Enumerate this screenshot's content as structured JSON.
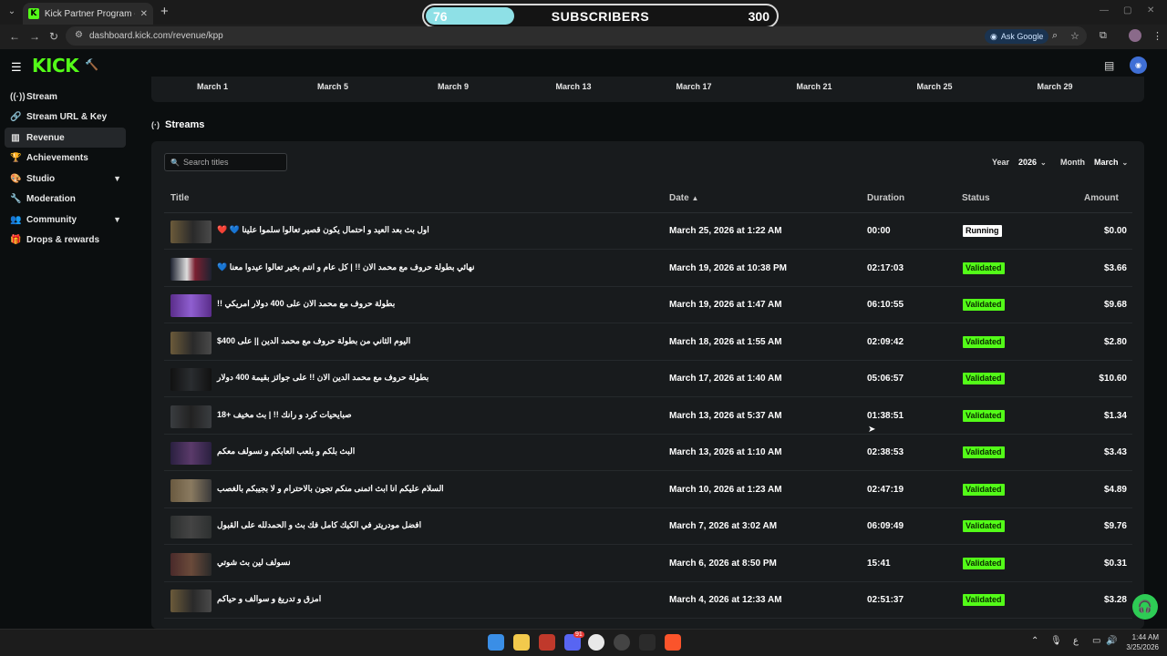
{
  "browser": {
    "tab_title": "Kick Partner Program - Kick Da",
    "url": "dashboard.kick.com/revenue/kpp",
    "ask_google": "Ask Google"
  },
  "overlay": {
    "current": "76",
    "label": "SUBSCRIBERS",
    "goal": "300",
    "progress_fraction": 0.253
  },
  "app": {
    "logo": "KICK"
  },
  "sidebar": {
    "items": [
      {
        "label": "Stream",
        "icon": "broadcast-icon"
      },
      {
        "label": "Stream URL & Key",
        "icon": "link-icon"
      },
      {
        "label": "Revenue",
        "icon": "bar-chart-icon"
      },
      {
        "label": "Achievements",
        "icon": "trophy-icon"
      },
      {
        "label": "Studio",
        "icon": "palette-icon"
      },
      {
        "label": "Moderation",
        "icon": "wrench-icon"
      },
      {
        "label": "Community",
        "icon": "people-icon"
      },
      {
        "label": "Drops & rewards",
        "icon": "gift-icon"
      }
    ]
  },
  "chart_axis": {
    "ticks": [
      "March 1",
      "March 5",
      "March 9",
      "March 13",
      "March 17",
      "March 21",
      "March 25",
      "March 29"
    ]
  },
  "streams": {
    "section_title": "Streams",
    "search_placeholder": "Search titles",
    "year_label": "Year",
    "year_value": "2026",
    "month_label": "Month",
    "month_value": "March",
    "columns": {
      "title": "Title",
      "date": "Date",
      "duration": "Duration",
      "status": "Status",
      "amount": "Amount"
    },
    "rows": [
      {
        "title": "اول بث بعد العيد و احتمال يكون قصير تعالوا سلموا علينا 💙 ❤️",
        "date": "March 25, 2026 at 1:22 AM",
        "duration": "00:00",
        "status": "Running",
        "amount": "$0.00"
      },
      {
        "title": "نهائي بطولة حروف مع محمد الان !! | كل عام و انتم بخير تعالوا عيدوا معنا 💙",
        "date": "March 19, 2026 at 10:38 PM",
        "duration": "02:17:03",
        "status": "Validated",
        "amount": "$3.66"
      },
      {
        "title": "بطولة حروف مع محمد الان على 400 دولار امريكي !!",
        "date": "March 19, 2026 at 1:47 AM",
        "duration": "06:10:55",
        "status": "Validated",
        "amount": "$9.68"
      },
      {
        "title": "اليوم الثاني من بطولة حروف مع محمد الدين || على 400$",
        "date": "March 18, 2026 at 1:55 AM",
        "duration": "02:09:42",
        "status": "Validated",
        "amount": "$2.80"
      },
      {
        "title": "بطولة حروف مع محمد الدين الان !! على جوائز بقيمة 400 دولار",
        "date": "March 17, 2026 at 1:40 AM",
        "duration": "05:06:57",
        "status": "Validated",
        "amount": "$10.60"
      },
      {
        "title": "صبايحيات كرد و رانك !! | بث مخيف +18",
        "date": "March 13, 2026 at 5:37 AM",
        "duration": "01:38:51",
        "status": "Validated",
        "amount": "$1.34"
      },
      {
        "title": "البث بلكم و بلعب العابكم و نسولف معكم",
        "date": "March 13, 2026 at 1:10 AM",
        "duration": "02:38:53",
        "status": "Validated",
        "amount": "$3.43"
      },
      {
        "title": "السلام عليكم انا ابث اتمنى منكم تجون بالاحترام و لا بجيبكم بالغصب",
        "date": "March 10, 2026 at 1:23 AM",
        "duration": "02:47:19",
        "status": "Validated",
        "amount": "$4.89"
      },
      {
        "title": "افضل مودريتر في الكيك كامل فك بث و الحمدلله على القبول",
        "date": "March 7, 2026 at 3:02 AM",
        "duration": "06:09:49",
        "status": "Validated",
        "amount": "$9.76"
      },
      {
        "title": "نسولف لين بث شوتي",
        "date": "March 6, 2026 at 8:50 PM",
        "duration": "15:41",
        "status": "Validated",
        "amount": "$0.31"
      },
      {
        "title": "امزق و تدريغ و سوالف و حياكم",
        "date": "March 4, 2026 at 12:33 AM",
        "duration": "02:51:37",
        "status": "Validated",
        "amount": "$3.28"
      }
    ]
  },
  "taskbar": {
    "time": "1:44 AM",
    "date": "3/25/2026",
    "discord_badge": "91"
  }
}
